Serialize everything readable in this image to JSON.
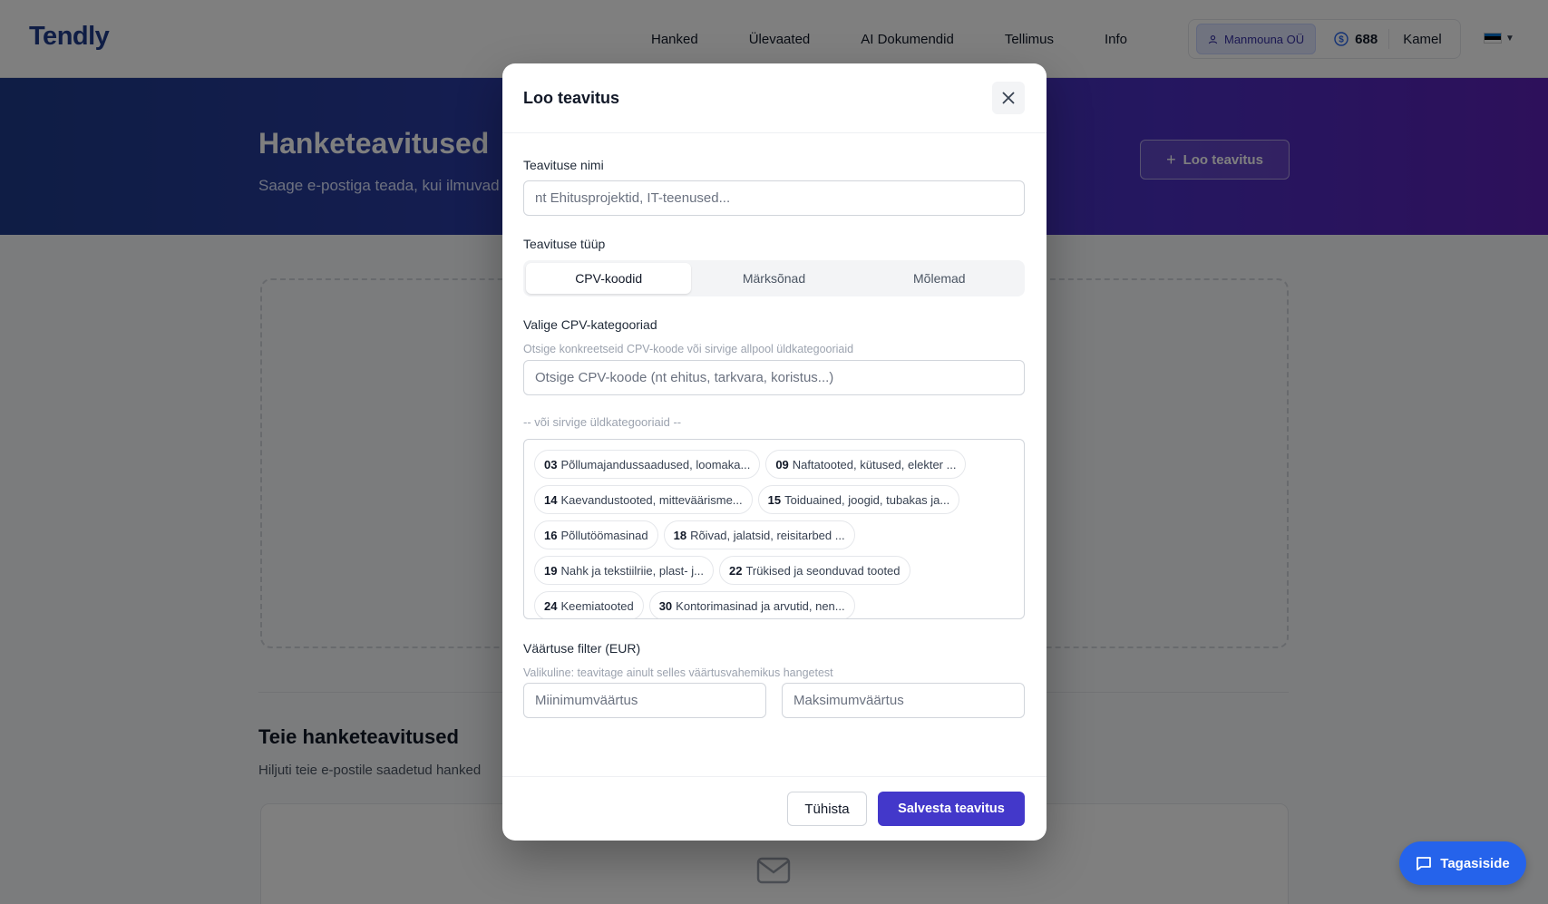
{
  "header": {
    "logo": "Tendly",
    "nav": [
      "Hanked",
      "Ülevaated",
      "AI Dokumendid",
      "Tellimus",
      "Info"
    ],
    "company": "Manmouna OÜ",
    "credits": "688",
    "username": "Kamel",
    "language_flag": "estonia-flag-icon"
  },
  "hero": {
    "title": "Hanketeavitused",
    "subtitle": "Saage e-postiga teada, kui ilmuvad te",
    "create_button": "Loo teavitus"
  },
  "section": {
    "title": "Teie hanketeavitused",
    "subtitle": "Hiljuti teie e-postile saadetud hanked"
  },
  "modal": {
    "title": "Loo teavitus",
    "name_label": "Teavituse nimi",
    "name_placeholder": "nt Ehitusprojektid, IT-teenused...",
    "type_label": "Teavituse tüüp",
    "type_options": [
      "CPV-koodid",
      "Märksõnad",
      "Mõlemad"
    ],
    "type_selected": "CPV-koodid",
    "cpv_label": "Valige CPV-kategooriad",
    "cpv_help": "Otsige konkreetseid CPV-koode või sirvige allpool üldkategooriaid",
    "cpv_search_placeholder": "Otsige CPV-koode (nt ehitus, tarkvara, koristus...)",
    "browse_hint": "-- või sirvige üldkategooriaid --",
    "categories": [
      {
        "code": "03",
        "name": "Põllumajandussaadused, loomaka..."
      },
      {
        "code": "09",
        "name": "Naftatooted, kütused, elekter ..."
      },
      {
        "code": "14",
        "name": "Kaevandustooted, mitteväärisme..."
      },
      {
        "code": "15",
        "name": "Toiduained, joogid, tubakas ja..."
      },
      {
        "code": "16",
        "name": "Põllutöömasinad"
      },
      {
        "code": "18",
        "name": "Rõivad, jalatsid, reisitarbed ..."
      },
      {
        "code": "19",
        "name": "Nahk ja tekstiilriie, plast- j..."
      },
      {
        "code": "22",
        "name": "Trükised ja seonduvad tooted"
      },
      {
        "code": "24",
        "name": "Keemiatooted"
      },
      {
        "code": "30",
        "name": "Kontorimasinad ja arvutid, nen..."
      }
    ],
    "value_label": "Väärtuse filter (EUR)",
    "value_help": "Valikuline: teavitage ainult selles väärtusvahemikus hangetest",
    "min_placeholder": "Miinimumväärtus",
    "max_placeholder": "Maksimumväärtus",
    "cancel": "Tühista",
    "save": "Salvesta teavitus"
  },
  "feedback_button": "Tagasiside",
  "colors": {
    "brand": "#1e3a8a",
    "primary_button": "#4338ca",
    "feedback_button": "#2563eb"
  }
}
